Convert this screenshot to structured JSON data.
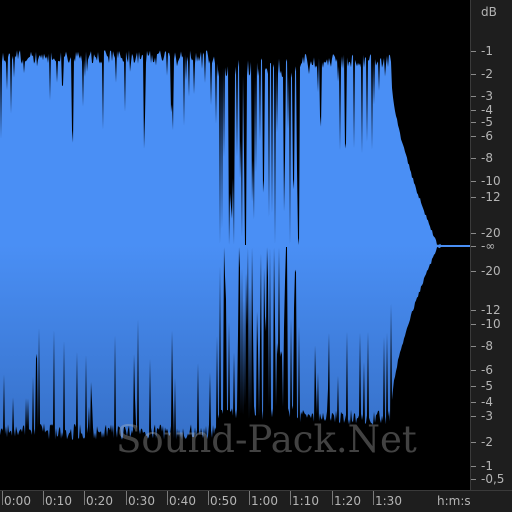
{
  "waveform": {
    "colors": {
      "background": "#000000",
      "wave_top": "#4a8ff5",
      "wave_bottom": "#3a74c9",
      "ruler_bg": "#1e1e1e",
      "ruler_text": "#b4b4b4"
    },
    "db_scale": {
      "unit": "dB",
      "labels": [
        "-1",
        "-2",
        "-3",
        "-4",
        "-5",
        "-6",
        "-8",
        "-10",
        "-12",
        "-20",
        "-∞",
        "-20",
        "-12",
        "-10",
        "-8",
        "-6",
        "-5",
        "-4",
        "-3",
        "-2",
        "-1",
        "-0,5"
      ]
    },
    "time_ruler": {
      "labels": [
        "0:00",
        "0:10",
        "0:20",
        "0:30",
        "0:40",
        "0:50",
        "1:00",
        "1:10",
        "1:20",
        "1:30"
      ],
      "unit": "h:m:s"
    },
    "watermark": "Sound-Pack.Net"
  }
}
